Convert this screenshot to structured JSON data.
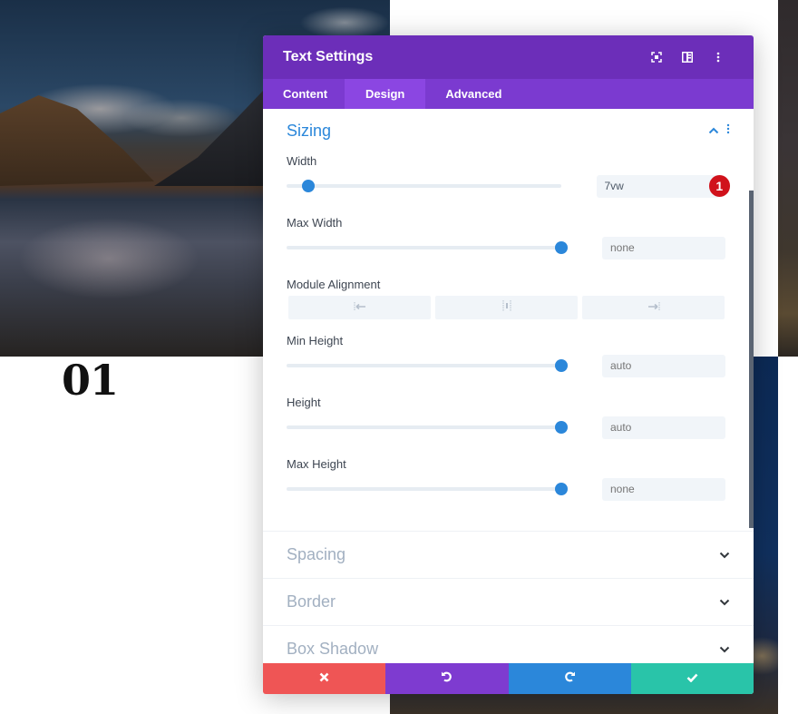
{
  "background": {
    "page_number": "01"
  },
  "modal": {
    "title": "Text Settings",
    "header_icons": [
      "focus-icon",
      "split-view-icon",
      "more-options-icon"
    ],
    "tabs": [
      {
        "label": "Content",
        "active": false
      },
      {
        "label": "Design",
        "active": true
      },
      {
        "label": "Advanced",
        "active": false
      }
    ],
    "sections": {
      "sizing": {
        "title": "Sizing",
        "expanded": true,
        "fields": [
          {
            "label": "Width",
            "value": "7vw",
            "slider_fraction": 0.08,
            "is_placeholder": false,
            "badge": "1"
          },
          {
            "label": "Max Width",
            "value": "none",
            "slider_fraction": 0.98,
            "is_placeholder": true
          },
          {
            "label": "Module Alignment",
            "options": [
              "align-left-icon",
              "align-center-icon",
              "align-right-icon"
            ]
          },
          {
            "label": "Min Height",
            "value": "auto",
            "slider_fraction": 0.98,
            "is_placeholder": true
          },
          {
            "label": "Height",
            "value": "auto",
            "slider_fraction": 0.98,
            "is_placeholder": true
          },
          {
            "label": "Max Height",
            "value": "none",
            "slider_fraction": 0.98,
            "is_placeholder": true
          }
        ]
      },
      "collapsed": [
        {
          "title": "Spacing"
        },
        {
          "title": "Border"
        },
        {
          "title": "Box Shadow"
        }
      ]
    },
    "footer": {
      "buttons": [
        {
          "name": "cancel",
          "icon": "close-icon",
          "color": "#ef5555"
        },
        {
          "name": "undo",
          "icon": "undo-icon",
          "color": "#7e3bd0"
        },
        {
          "name": "redo",
          "icon": "redo-icon",
          "color": "#2b87da"
        },
        {
          "name": "save",
          "icon": "check-icon",
          "color": "#29c4a9"
        }
      ]
    }
  },
  "colors": {
    "header": "#6c2eb9",
    "tabs": "#7b3ad0",
    "active_tab": "#8b46e2",
    "accent": "#2b87da",
    "badge": "#d0121b"
  }
}
